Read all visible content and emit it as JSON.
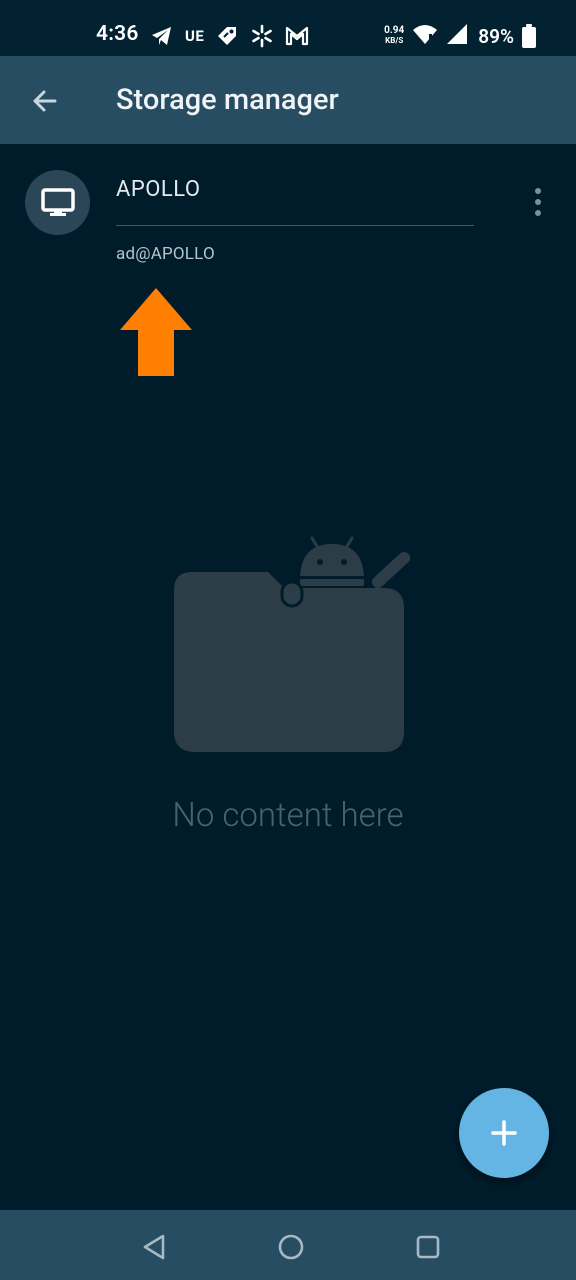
{
  "status_bar": {
    "time": "4:36",
    "carrier_text": "UE",
    "net_speed_value": "0.94",
    "net_speed_unit": "KB/S",
    "battery": "89%",
    "icons": [
      "telegram-icon",
      "ue-icon",
      "tag-icon",
      "walmart-spark-icon",
      "gmail-icon",
      "wifi-icon",
      "signal-icon",
      "battery-icon"
    ]
  },
  "app_bar": {
    "title": "Storage manager",
    "back_icon": "arrow-back-icon"
  },
  "storage_entry": {
    "name": "APOLLO",
    "subtitle": "ad@APOLLO",
    "icon": "monitor-icon",
    "more_icon": "more-vert-icon"
  },
  "annotation": {
    "icon": "orange-up-arrow",
    "color": "#ff7f00"
  },
  "empty_state": {
    "message": "No content here",
    "illustration": "folder-with-android-icon"
  },
  "fab": {
    "icon": "plus-icon",
    "color": "#64b5e3"
  },
  "nav_bar": {
    "icons": [
      "nav-back-icon",
      "nav-home-icon",
      "nav-recents-icon"
    ]
  },
  "colors": {
    "background": "#001c2b",
    "app_bar": "#264d62",
    "accent": "#64b5e3"
  }
}
